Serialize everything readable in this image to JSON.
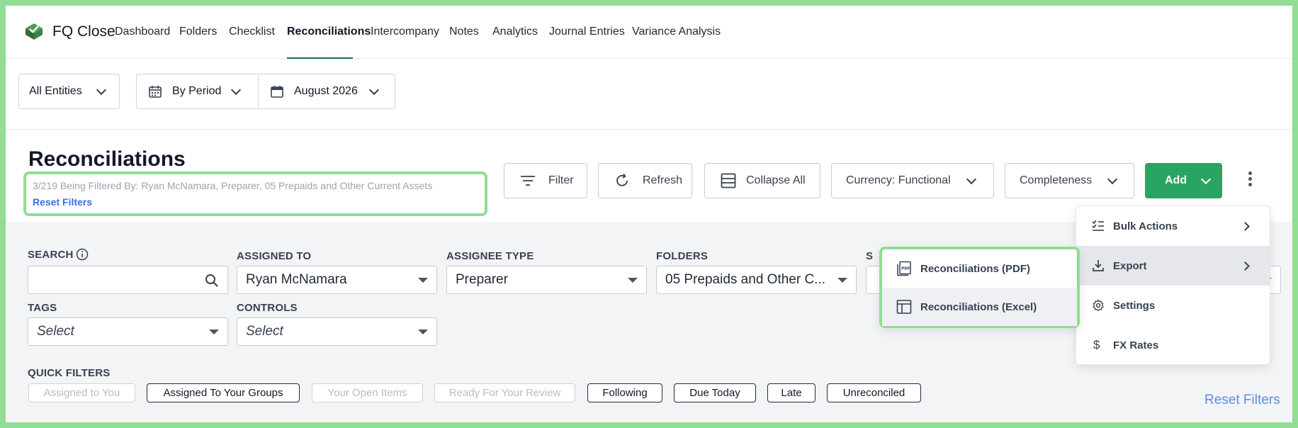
{
  "app": {
    "brand": "FQ Close"
  },
  "nav": {
    "items": [
      {
        "label": "Dashboard"
      },
      {
        "label": "Folders"
      },
      {
        "label": "Checklist"
      },
      {
        "label": "Reconciliations"
      },
      {
        "label": "Intercompany"
      },
      {
        "label": "Notes"
      },
      {
        "label": "Analytics"
      },
      {
        "label": "Journal Entries"
      },
      {
        "label": "Variance Analysis"
      }
    ],
    "active": "Reconciliations"
  },
  "filters": {
    "entities": "All Entities",
    "period_mode": "By Period",
    "period": "August 2026"
  },
  "header": {
    "title": "Reconciliations",
    "filter_summary": "3/219 Being Filtered By: Ryan McNamara, Preparer, 05 Prepaids and Other Current Assets",
    "reset_filters": "Reset Filters"
  },
  "toolbar": {
    "filter": "Filter",
    "refresh": "Refresh",
    "collapse_all": "Collapse All",
    "currency": "Currency: Functional",
    "completeness": "Completeness",
    "add": "Add"
  },
  "search": {
    "search_label": "SEARCH",
    "search_value": "",
    "assigned_to_label": "ASSIGNED TO",
    "assigned_to_value": "Ryan McNamara",
    "assignee_type_label": "ASSIGNEE TYPE",
    "assignee_type_value": "Preparer",
    "folders_label": "FOLDERS",
    "folders_value": "05 Prepaids and Other C...",
    "hidden_label_partial": "S",
    "tags_label": "TAGS",
    "tags_value": "Select",
    "controls_label": "CONTROLS",
    "controls_value": "Select"
  },
  "quick_filters": {
    "label": "QUICK FILTERS",
    "chips": [
      {
        "label": "Assigned to You",
        "enabled": false
      },
      {
        "label": "Assigned To Your Groups",
        "enabled": true
      },
      {
        "label": "Your Open Items",
        "enabled": false
      },
      {
        "label": "Ready For Your Review",
        "enabled": false
      },
      {
        "label": "Following",
        "enabled": true
      },
      {
        "label": "Due Today",
        "enabled": true
      },
      {
        "label": "Late",
        "enabled": true
      },
      {
        "label": "Unreconciled",
        "enabled": true
      }
    ],
    "reset": "Reset Filters"
  },
  "menu": {
    "items": [
      {
        "label": "Bulk Actions",
        "icon": "checklist-icon"
      },
      {
        "label": "Export",
        "icon": "download-icon"
      },
      {
        "label": "Settings",
        "icon": "gear-icon"
      },
      {
        "label": "FX Rates",
        "icon": "dollar-icon"
      }
    ],
    "export_submenu": [
      {
        "label": "Reconciliations (PDF)",
        "icon": "pdf-icon"
      },
      {
        "label": "Reconciliations (Excel)",
        "icon": "table-icon"
      }
    ]
  },
  "colors": {
    "accent_green": "#2aa463",
    "highlight_green": "#8fde93",
    "link_blue": "#3b6fe0",
    "nav_underline": "#1f6b4d"
  }
}
